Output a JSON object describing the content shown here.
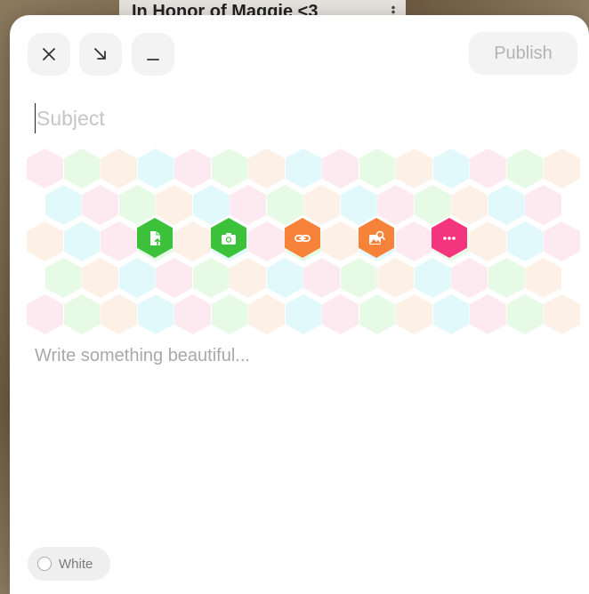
{
  "background": {
    "post_title": "In Honor of Maggie <3"
  },
  "toolbar": {
    "close_icon": "close-icon",
    "minimize_icon": "arrow-down-right-icon",
    "collapse_icon": "minus-icon",
    "publish_label": "Publish"
  },
  "editor": {
    "subject_placeholder": "Subject",
    "body_placeholder": "Write something beautiful..."
  },
  "attachments": [
    {
      "name": "file-upload-icon",
      "color": "#3cc13b"
    },
    {
      "name": "camera-icon",
      "color": "#3cc13b"
    },
    {
      "name": "link-icon",
      "color": "#f7823a"
    },
    {
      "name": "image-search-icon",
      "color": "#f7823a"
    },
    {
      "name": "more-icon",
      "color": "#f2357d"
    }
  ],
  "hex_palette": [
    "#fdeaf1",
    "#e6fae6",
    "#fdf0e6",
    "#e2f9fc"
  ],
  "theme": {
    "label": "White",
    "swatch": "#ffffff"
  }
}
